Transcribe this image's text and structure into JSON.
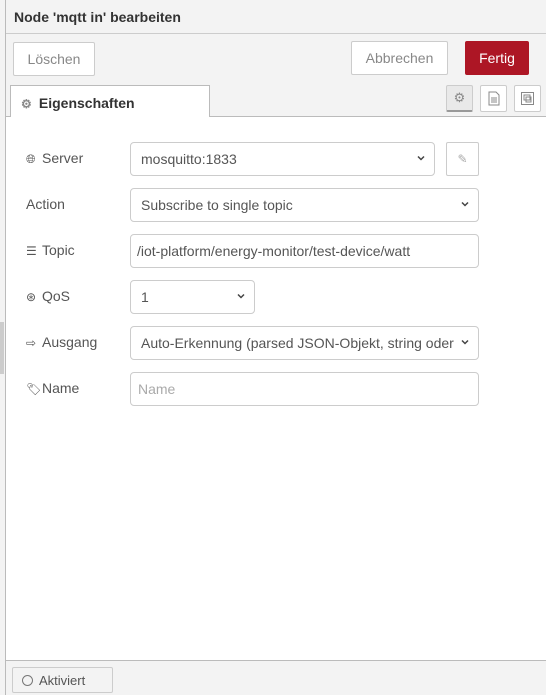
{
  "header": {
    "title": "Node 'mqtt in' bearbeiten"
  },
  "toolbar": {
    "delete_label": "Löschen",
    "cancel_label": "Abbrechen",
    "done_label": "Fertig",
    "done_color": "#ad1625"
  },
  "tabs": [
    {
      "label": "Eigenschaften",
      "icon": "gear-icon",
      "active": true
    }
  ],
  "tab_icons": [
    "gear-icon",
    "document-icon",
    "layout-icon"
  ],
  "form": {
    "server": {
      "label": "Server",
      "icon": "globe-icon",
      "value": "mosquitto:1833"
    },
    "action": {
      "label": "Action",
      "value": "Subscribe to single topic"
    },
    "topic": {
      "label": "Topic",
      "icon": "tasks-icon",
      "value": "/iot-platform/energy-monitor/test-device/watt"
    },
    "qos": {
      "label": "QoS",
      "icon": "qos-icon",
      "value": "1"
    },
    "output": {
      "label": "Ausgang",
      "icon": "sign-out-icon",
      "value": "Auto-Erkennung (parsed JSON-Objekt, string oder"
    },
    "name": {
      "label": "Name",
      "icon": "tag-icon",
      "value": "",
      "placeholder": "Name"
    }
  },
  "footer": {
    "toggle_label": "Aktiviert",
    "enabled": true
  }
}
